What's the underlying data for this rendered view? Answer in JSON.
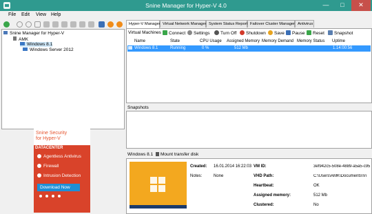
{
  "window": {
    "title": "Snine Manager for Hyper-V 4.0",
    "min": "—",
    "max": "□",
    "close": "✕"
  },
  "menu": [
    "File",
    "Edit",
    "View",
    "Help"
  ],
  "tree": {
    "root": "Snine Manager for Hyper-V",
    "host": "AMK",
    "vms": [
      "Windows 8.1",
      "Windows Server 2012"
    ]
  },
  "ad": {
    "line1": "Snine Security",
    "line2": "for Hyper-V",
    "datacenter": "DATACENTER",
    "features": [
      "Agentless Antivirus",
      "Firewall",
      "Intrusion Detection"
    ],
    "download": "Download Now"
  },
  "tabs": [
    "Hyper-V Manager",
    "Virtual Network Manager",
    "System Status Report",
    "Failover Cluster Manager",
    "Antivirus"
  ],
  "vm_toolbar": {
    "label": "Virtual Machines",
    "connect": "Connect",
    "settings": "Settings",
    "turn_off": "Turn Off",
    "shutdown": "Shutdown",
    "save": "Save",
    "pause": "Pause",
    "reset": "Reset",
    "snapshot": "Snapshot"
  },
  "columns": [
    "Name",
    "State",
    "CPU Usage",
    "Assigned Memory",
    "Memory Demand",
    "Memory Status",
    "Uptime"
  ],
  "vm_rows": [
    {
      "name": "Windows 8.1",
      "state": "Running",
      "cpu": "0 %",
      "assigned_memory": "512 Mb",
      "memory_demand": "",
      "memory_status": "",
      "uptime": "1.14:00:56"
    }
  ],
  "snapshots_label": "Snapshots",
  "detail": {
    "vm_name": "Windows 8.1",
    "mount_label": "Mount transfer disk",
    "created_label": "Created:",
    "created_value": "16.01.2014 16:22:03",
    "notes_label": "Notes:",
    "notes_value": "None",
    "vmid_label": "VM ID:",
    "vmid_value": "3ef942c5-508e-4889-a5a5-c95",
    "vhd_label": "VHD Path:",
    "vhd_value": "C:\\Users\\AMK\\Documents\\Vi",
    "heartbeat_label": "Heartbeat:",
    "heartbeat_value": "OK",
    "assigned_label": "Assigned memory:",
    "assigned_value": "512 Mb",
    "clustered_label": "Clustered:",
    "clustered_value": "No"
  },
  "colors": {
    "titlebar": "#2f9a8f",
    "selection": "#3399ff",
    "ad_red": "#d9432a",
    "ad_blue": "#1e8fd6",
    "vm_thumb": "#f3a81f"
  }
}
